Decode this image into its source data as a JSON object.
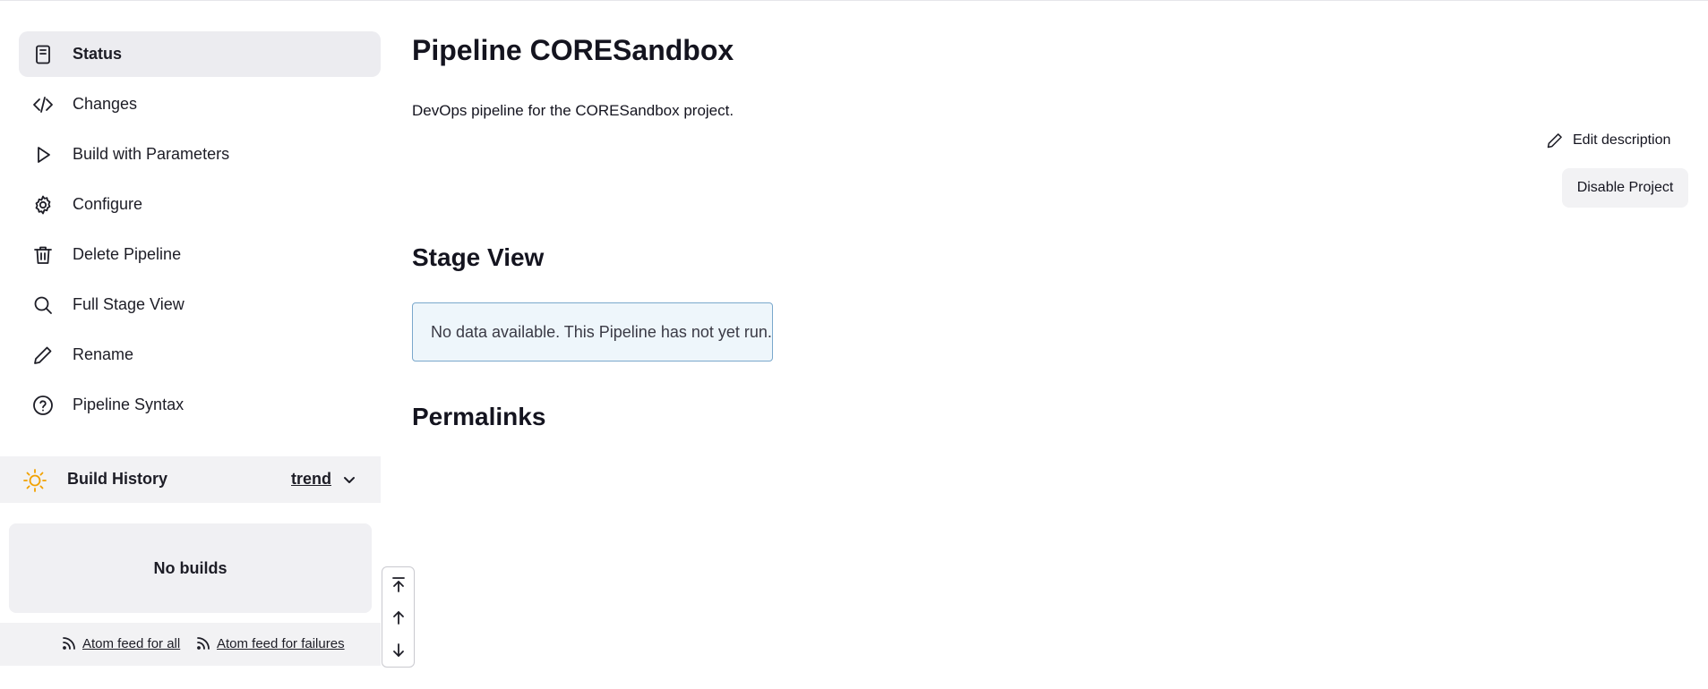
{
  "sidebar": {
    "items": [
      {
        "label": "Status",
        "icon": "document-icon",
        "active": true
      },
      {
        "label": "Changes",
        "icon": "code-icon"
      },
      {
        "label": "Build with Parameters",
        "icon": "play-icon"
      },
      {
        "label": "Configure",
        "icon": "gear-icon"
      },
      {
        "label": "Delete Pipeline",
        "icon": "trash-icon"
      },
      {
        "label": "Full Stage View",
        "icon": "search-icon"
      },
      {
        "label": "Rename",
        "icon": "pencil-icon"
      },
      {
        "label": "Pipeline Syntax",
        "icon": "help-circle-icon"
      }
    ]
  },
  "build_history": {
    "title": "Build History",
    "trend_label": "trend",
    "weather_icon": "sun-icon",
    "weather_color": "#f2a100",
    "empty_text": "No builds",
    "atom_all": "Atom feed for all",
    "atom_failures": "Atom feed for failures"
  },
  "main": {
    "title": "Pipeline CORESandbox",
    "description": "DevOps pipeline for the CORESandbox project.",
    "edit_description": "Edit description",
    "disable_project": "Disable Project",
    "stage_view_title": "Stage View",
    "stage_view_notice": "No data available. This Pipeline has not yet run.",
    "permalinks_title": "Permalinks"
  }
}
